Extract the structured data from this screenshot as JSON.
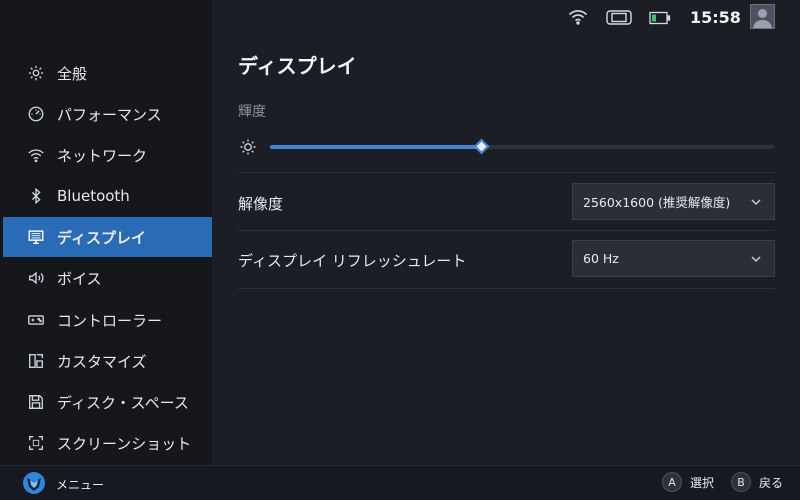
{
  "status": {
    "time": "15:58",
    "icons": [
      "wifi-icon",
      "handheld-device-icon",
      "battery-icon",
      "avatar-icon"
    ]
  },
  "sidebar": {
    "items": [
      {
        "label": "全般",
        "icon": "gear-icon"
      },
      {
        "label": "パフォーマンス",
        "icon": "gauge-icon"
      },
      {
        "label": "ネットワーク",
        "icon": "wifi-icon"
      },
      {
        "label": "Bluetooth",
        "icon": "bluetooth-icon"
      },
      {
        "label": "ディスプレイ",
        "icon": "monitor-icon",
        "active": true
      },
      {
        "label": "ボイス",
        "icon": "speaker-icon"
      },
      {
        "label": "コントローラー",
        "icon": "controller-icon"
      },
      {
        "label": "カスタマイズ",
        "icon": "grid-icon"
      },
      {
        "label": "ディスク・スペース",
        "icon": "disk-icon"
      },
      {
        "label": "スクリーンショット",
        "icon": "screenshot-icon"
      }
    ]
  },
  "main": {
    "title": "ディスプレイ",
    "brightness": {
      "label": "輝度",
      "value": 0.42
    },
    "resolution": {
      "label": "解像度",
      "selected": "2560x1600 (推奨解像度)"
    },
    "refresh_rate": {
      "label": "ディスプレイ リフレッシュレート",
      "selected": "60 Hz"
    }
  },
  "footer": {
    "menu_label": "メニュー",
    "hints": [
      {
        "button": "A",
        "label": "選択"
      },
      {
        "button": "B",
        "label": "戻る"
      }
    ]
  },
  "colors": {
    "accent": "#2a6bb5",
    "slider": "#3f86d4",
    "background": "#1b1e25",
    "sidebar": "#15171d"
  }
}
